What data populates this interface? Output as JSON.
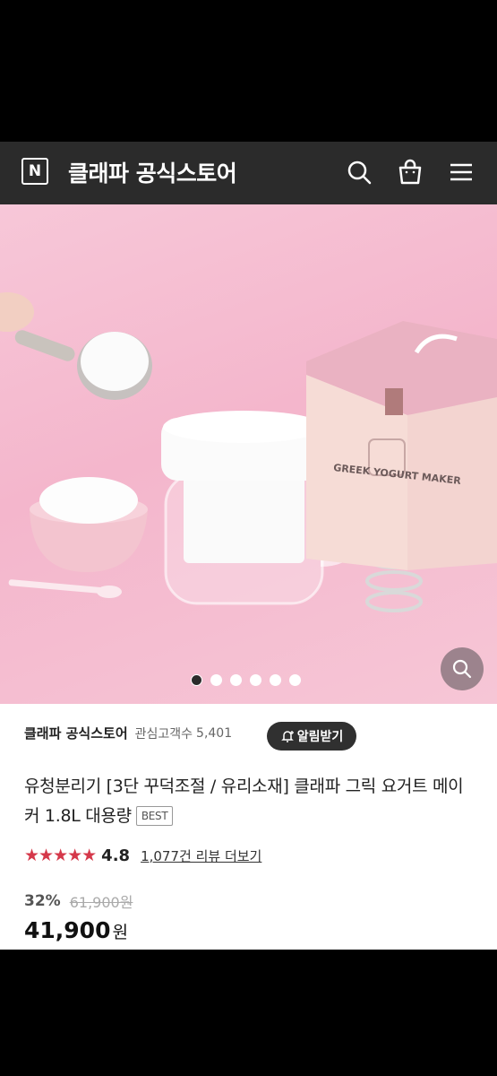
{
  "header": {
    "logo_letter": "N",
    "store_title": "클래파 공식스토어",
    "icons": [
      "search-icon",
      "shopping-bag-icon",
      "menu-icon"
    ]
  },
  "hero": {
    "box_label": "GREEK YOGURT MAKER",
    "carousel_total": 6,
    "carousel_active": 1,
    "zoom_icon": "search-icon"
  },
  "seller": {
    "name": "클래파 공식스토어",
    "followers_label": "관심고객수",
    "followers_count": "5,401",
    "alert_button": "알림받기",
    "alert_icon": "bell-plus-icon"
  },
  "product": {
    "title": "유청분리기 [3단 꾸덕조절 / 유리소재] 클래파 그릭 요거트 메이커 1.8L 대용량",
    "badge": "BEST",
    "stars": "★★★★★",
    "rating": "4.8",
    "review_link": "1,077건 리뷰 더보기",
    "discount": "32%",
    "original_price": "61,900원",
    "price": "41,900",
    "currency": "원"
  },
  "colors": {
    "header_bg": "#2b2b2b",
    "star": "#d5384a",
    "hero_bg": "#f4b6cc"
  }
}
